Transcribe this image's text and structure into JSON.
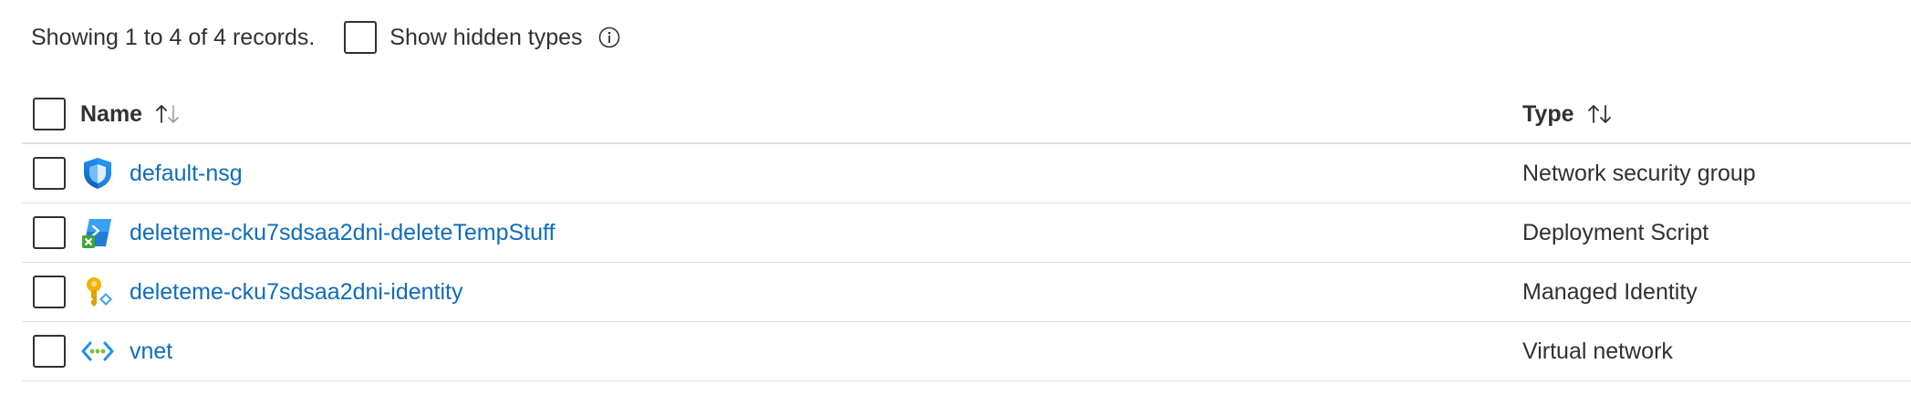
{
  "toolbar": {
    "summary": "Showing 1 to 4 of 4 records.",
    "show_hidden_label": "Show hidden types",
    "info_icon": "info-icon"
  },
  "table": {
    "columns": [
      {
        "label": "Name",
        "sort": "ascending"
      },
      {
        "label": "Type",
        "sort": "none"
      }
    ],
    "rows": [
      {
        "name": "default-nsg",
        "type": "Network security group",
        "icon": "network-security-group-icon"
      },
      {
        "name": "deleteme-cku7sdsaa2dni-deleteTempStuff",
        "type": "Deployment Script",
        "icon": "deployment-script-icon"
      },
      {
        "name": "deleteme-cku7sdsaa2dni-identity",
        "type": "Managed Identity",
        "icon": "managed-identity-icon"
      },
      {
        "name": "vnet",
        "type": "Virtual network",
        "icon": "virtual-network-icon"
      }
    ]
  },
  "colors": {
    "link": "#0f6cbd",
    "text": "#323130",
    "border": "#e1dfdd"
  }
}
